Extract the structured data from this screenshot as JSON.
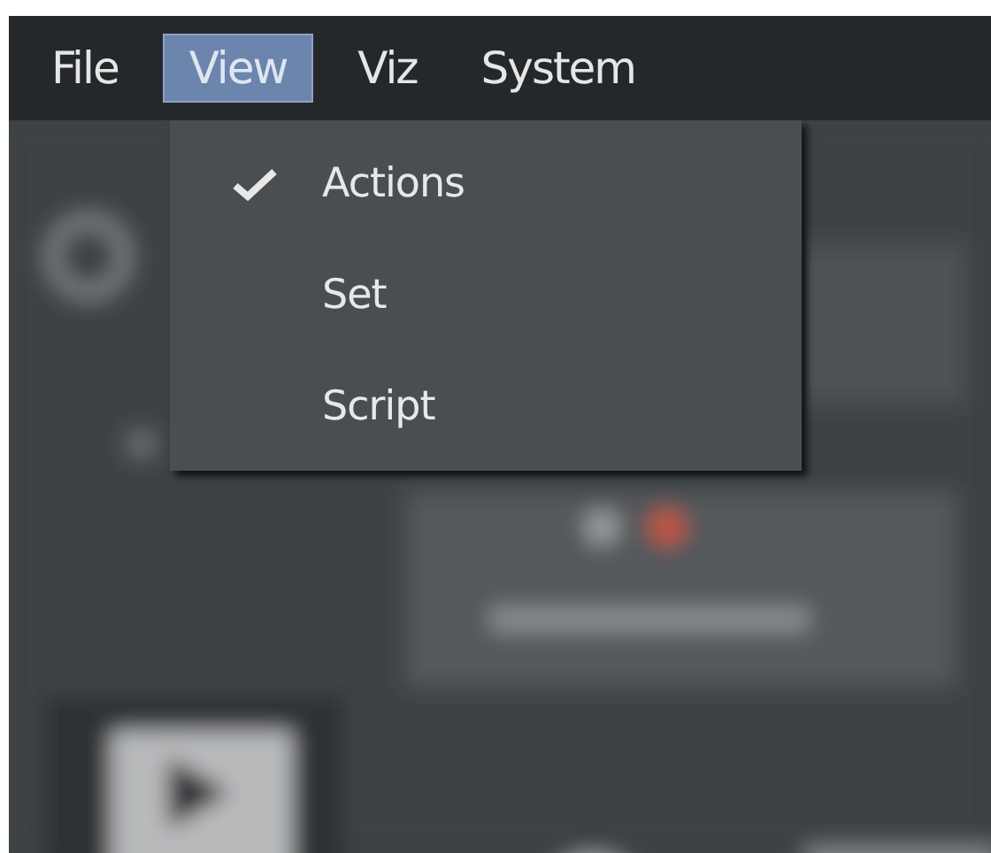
{
  "menu_bar": [
    {
      "label": "File",
      "selected": false
    },
    {
      "label": "View",
      "selected": true
    },
    {
      "label": "Viz",
      "selected": false
    },
    {
      "label": "System",
      "selected": false
    }
  ],
  "dropdown": {
    "items": [
      {
        "label": "Actions",
        "checked": true
      },
      {
        "label": "Set",
        "checked": false
      },
      {
        "label": "Script",
        "checked": false
      }
    ]
  }
}
